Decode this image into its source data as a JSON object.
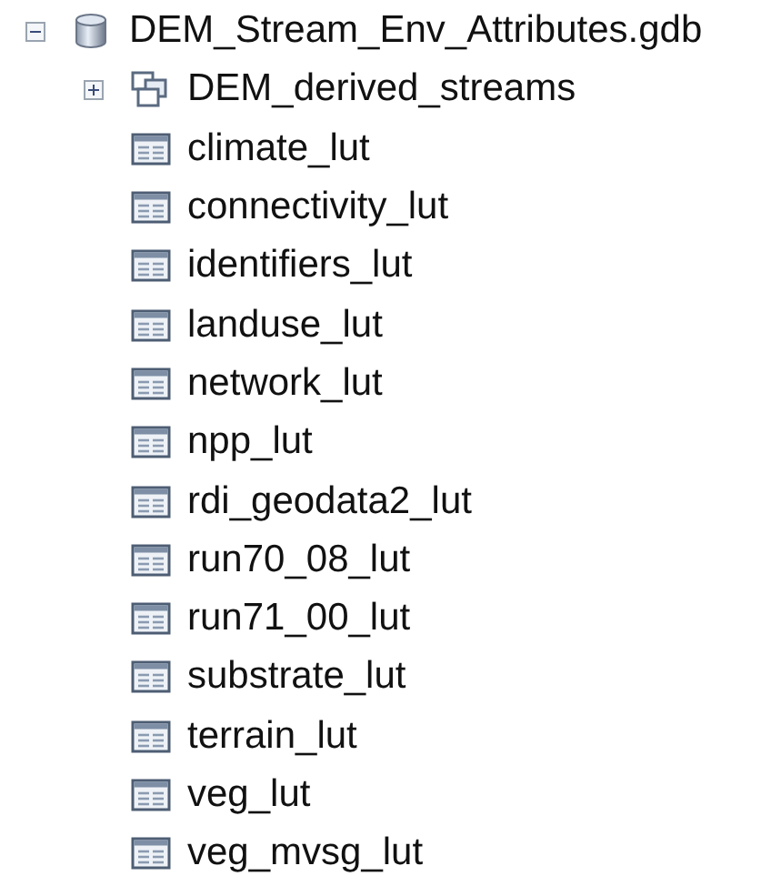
{
  "tree": [
    {
      "label": "DEM_Stream_Env_Attributes.gdb",
      "kind": "geodatabase",
      "expanded": true,
      "children": [
        {
          "label": "DEM_derived_streams",
          "kind": "feature_dataset",
          "expanded": false
        },
        {
          "label": "climate_lut",
          "kind": "table"
        },
        {
          "label": "connectivity_lut",
          "kind": "table"
        },
        {
          "label": "identifiers_lut",
          "kind": "table"
        },
        {
          "label": "landuse_lut",
          "kind": "table"
        },
        {
          "label": "network_lut",
          "kind": "table"
        },
        {
          "label": "npp_lut",
          "kind": "table"
        },
        {
          "label": "rdi_geodata2_lut",
          "kind": "table"
        },
        {
          "label": "run70_08_lut",
          "kind": "table"
        },
        {
          "label": "run71_00_lut",
          "kind": "table"
        },
        {
          "label": "substrate_lut",
          "kind": "table"
        },
        {
          "label": "terrain_lut",
          "kind": "table"
        },
        {
          "label": "veg_lut",
          "kind": "table"
        },
        {
          "label": "veg_mvsg_lut",
          "kind": "table"
        }
      ]
    }
  ]
}
